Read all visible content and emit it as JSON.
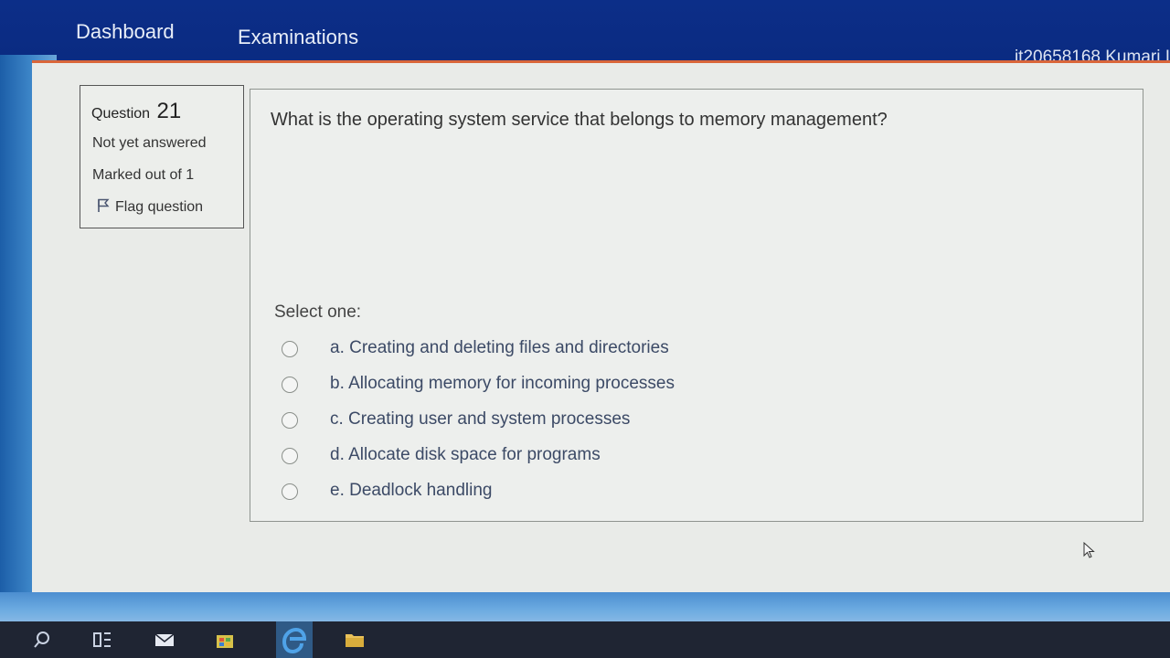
{
  "navbar": {
    "links": [
      "Dashboard",
      "Examinations"
    ],
    "user": "it20658168 Kumari I"
  },
  "question_info": {
    "label": "Question",
    "number": "21",
    "status": "Not yet answered",
    "marks": "Marked out of 1",
    "flag_label": "Flag question",
    "flag_icon": "flag-icon"
  },
  "question": {
    "text": "What is the operating system service that belongs to memory management?",
    "prompt": "Select one:",
    "options": [
      "a. Creating and deleting files and directories",
      "b. Allocating memory for incoming processes",
      "c. Creating user and system processes",
      "d. Allocate disk space for programs",
      "e. Deadlock handling"
    ],
    "selected": null
  },
  "taskbar": {
    "icons": [
      "search-icon",
      "task-view-icon",
      "mail-icon",
      "store-icon",
      "edge-icon",
      "file-explorer-icon"
    ]
  },
  "colors": {
    "navbar": "#0c2e88",
    "accent_border": "#d9663a",
    "page_background": "#e9ebe8",
    "option_text": "#3c4a66"
  }
}
